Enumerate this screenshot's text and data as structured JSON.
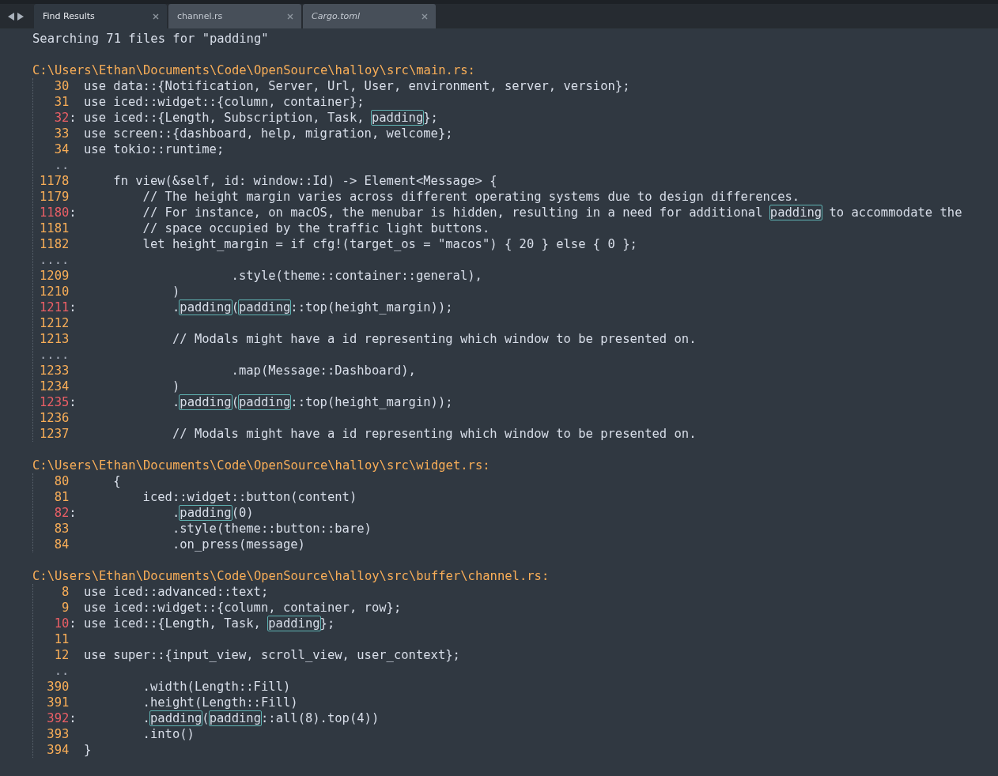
{
  "tabs": [
    {
      "label": "Find Results",
      "selected": true,
      "preview": false
    },
    {
      "label": "channel.rs",
      "selected": false,
      "preview": false
    },
    {
      "label": "Cargo.toml",
      "selected": false,
      "preview": true
    }
  ],
  "header": "Searching 71 files for \"padding\"",
  "groups": [
    {
      "path": "C:\\Users\\Ethan\\Documents\\Code\\OpenSource\\halloy\\src\\main.rs:",
      "lines": [
        {
          "kind": "line",
          "number": "30",
          "match": false,
          "segments": [
            {
              "text": "use data::{Notification, Server, Url, User, environment, server, version};",
              "highlighted": false
            }
          ]
        },
        {
          "kind": "line",
          "number": "31",
          "match": false,
          "segments": [
            {
              "text": "use iced::widget::{column, container};",
              "highlighted": false
            }
          ]
        },
        {
          "kind": "line",
          "number": "32",
          "match": true,
          "marker": ":",
          "segments": [
            {
              "text": "use iced::{Length, Subscription, Task, ",
              "highlighted": false
            },
            {
              "text": "padding",
              "highlighted": true
            },
            {
              "text": "};",
              "highlighted": false
            }
          ]
        },
        {
          "kind": "line",
          "number": "33",
          "match": false,
          "segments": [
            {
              "text": "use screen::{dashboard, help, migration, welcome};",
              "highlighted": false
            }
          ]
        },
        {
          "kind": "line",
          "number": "34",
          "match": false,
          "segments": [
            {
              "text": "use tokio::runtime;",
              "highlighted": false
            }
          ]
        },
        {
          "kind": "gap",
          "text": ".."
        },
        {
          "kind": "line",
          "number": "1178",
          "match": false,
          "segments": [
            {
              "text": "    fn view(&self, id: window::Id) -> Element<Message> {",
              "highlighted": false
            }
          ]
        },
        {
          "kind": "line",
          "number": "1179",
          "match": false,
          "segments": [
            {
              "text": "        // The height margin varies across different operating systems due to design differences.",
              "highlighted": false
            }
          ]
        },
        {
          "kind": "line",
          "number": "1180",
          "match": true,
          "marker": ":",
          "segments": [
            {
              "text": "        // For instance, on macOS, the menubar is hidden, resulting in a need for additional ",
              "highlighted": false
            },
            {
              "text": "padding",
              "highlighted": true
            },
            {
              "text": " to accommodate the",
              "highlighted": false
            }
          ]
        },
        {
          "kind": "line",
          "number": "1181",
          "match": false,
          "segments": [
            {
              "text": "        // space occupied by the traffic light buttons.",
              "highlighted": false
            }
          ]
        },
        {
          "kind": "line",
          "number": "1182",
          "match": false,
          "segments": [
            {
              "text": "        let height_margin = if cfg!(target_os = \"macos\") { 20 } else { 0 };",
              "highlighted": false
            }
          ]
        },
        {
          "kind": "gap",
          "text": "...."
        },
        {
          "kind": "line",
          "number": "1209",
          "match": false,
          "segments": [
            {
              "text": "                    .style(theme::container::general),",
              "highlighted": false
            }
          ]
        },
        {
          "kind": "line",
          "number": "1210",
          "match": false,
          "segments": [
            {
              "text": "            )",
              "highlighted": false
            }
          ]
        },
        {
          "kind": "line",
          "number": "1211",
          "match": true,
          "marker": ":",
          "segments": [
            {
              "text": "            .",
              "highlighted": false
            },
            {
              "text": "padding",
              "highlighted": true
            },
            {
              "text": "(",
              "highlighted": false
            },
            {
              "text": "padding",
              "highlighted": true
            },
            {
              "text": "::top(height_margin));",
              "highlighted": false
            }
          ]
        },
        {
          "kind": "line",
          "number": "1212",
          "match": false
        },
        {
          "kind": "line",
          "number": "1213",
          "match": false,
          "segments": [
            {
              "text": "            // Modals might have a id representing which window to be presented on.",
              "highlighted": false
            }
          ]
        },
        {
          "kind": "gap",
          "text": "...."
        },
        {
          "kind": "line",
          "number": "1233",
          "match": false,
          "segments": [
            {
              "text": "                    .map(Message::Dashboard),",
              "highlighted": false
            }
          ]
        },
        {
          "kind": "line",
          "number": "1234",
          "match": false,
          "segments": [
            {
              "text": "            )",
              "highlighted": false
            }
          ]
        },
        {
          "kind": "line",
          "number": "1235",
          "match": true,
          "marker": ":",
          "segments": [
            {
              "text": "            .",
              "highlighted": false
            },
            {
              "text": "padding",
              "highlighted": true
            },
            {
              "text": "(",
              "highlighted": false
            },
            {
              "text": "padding",
              "highlighted": true
            },
            {
              "text": "::top(height_margin));",
              "highlighted": false
            }
          ]
        },
        {
          "kind": "line",
          "number": "1236",
          "match": false
        },
        {
          "kind": "line",
          "number": "1237",
          "match": false,
          "segments": [
            {
              "text": "            // Modals might have a id representing which window to be presented on.",
              "highlighted": false
            }
          ]
        }
      ]
    },
    {
      "path": "C:\\Users\\Ethan\\Documents\\Code\\OpenSource\\halloy\\src\\widget.rs:",
      "lines": [
        {
          "kind": "line",
          "number": "80",
          "match": false,
          "segments": [
            {
              "text": "    {",
              "highlighted": false
            }
          ]
        },
        {
          "kind": "line",
          "number": "81",
          "match": false,
          "segments": [
            {
              "text": "        iced::widget::button(content)",
              "highlighted": false
            }
          ]
        },
        {
          "kind": "line",
          "number": "82",
          "match": true,
          "marker": ":",
          "segments": [
            {
              "text": "            .",
              "highlighted": false
            },
            {
              "text": "padding",
              "highlighted": true
            },
            {
              "text": "(0)",
              "highlighted": false
            }
          ]
        },
        {
          "kind": "line",
          "number": "83",
          "match": false,
          "segments": [
            {
              "text": "            .style(theme::button::bare)",
              "highlighted": false
            }
          ]
        },
        {
          "kind": "line",
          "number": "84",
          "match": false,
          "segments": [
            {
              "text": "            .on_press(message)",
              "highlighted": false
            }
          ]
        }
      ]
    },
    {
      "path": "C:\\Users\\Ethan\\Documents\\Code\\OpenSource\\halloy\\src\\buffer\\channel.rs:",
      "lines": [
        {
          "kind": "line",
          "number": "8",
          "match": false,
          "segments": [
            {
              "text": "use iced::advanced::text;",
              "highlighted": false
            }
          ]
        },
        {
          "kind": "line",
          "number": "9",
          "match": false,
          "segments": [
            {
              "text": "use iced::widget::{column, container, row};",
              "highlighted": false
            }
          ]
        },
        {
          "kind": "line",
          "number": "10",
          "match": true,
          "marker": ":",
          "segments": [
            {
              "text": "use iced::{Length, Task, ",
              "highlighted": false
            },
            {
              "text": "padding",
              "highlighted": true
            },
            {
              "text": "};",
              "highlighted": false
            }
          ]
        },
        {
          "kind": "line",
          "number": "11",
          "match": false
        },
        {
          "kind": "line",
          "number": "12",
          "match": false,
          "segments": [
            {
              "text": "use super::{input_view, scroll_view, user_context};",
              "highlighted": false
            }
          ]
        },
        {
          "kind": "gap",
          "text": ".."
        },
        {
          "kind": "line",
          "number": "390",
          "match": false,
          "segments": [
            {
              "text": "        .width(Length::Fill)",
              "highlighted": false
            }
          ]
        },
        {
          "kind": "line",
          "number": "391",
          "match": false,
          "segments": [
            {
              "text": "        .height(Length::Fill)",
              "highlighted": false
            }
          ]
        },
        {
          "kind": "line",
          "number": "392",
          "match": true,
          "marker": ":",
          "segments": [
            {
              "text": "        .",
              "highlighted": false
            },
            {
              "text": "padding",
              "highlighted": true
            },
            {
              "text": "(",
              "highlighted": false
            },
            {
              "text": "padding",
              "highlighted": true
            },
            {
              "text": "::all(8).top(4))",
              "highlighted": false
            }
          ]
        },
        {
          "kind": "line",
          "number": "393",
          "match": false,
          "segments": [
            {
              "text": "        .into()",
              "highlighted": false
            }
          ]
        },
        {
          "kind": "line",
          "number": "394",
          "match": false,
          "segments": [
            {
              "text": "}",
              "highlighted": false
            }
          ]
        }
      ]
    }
  ]
}
